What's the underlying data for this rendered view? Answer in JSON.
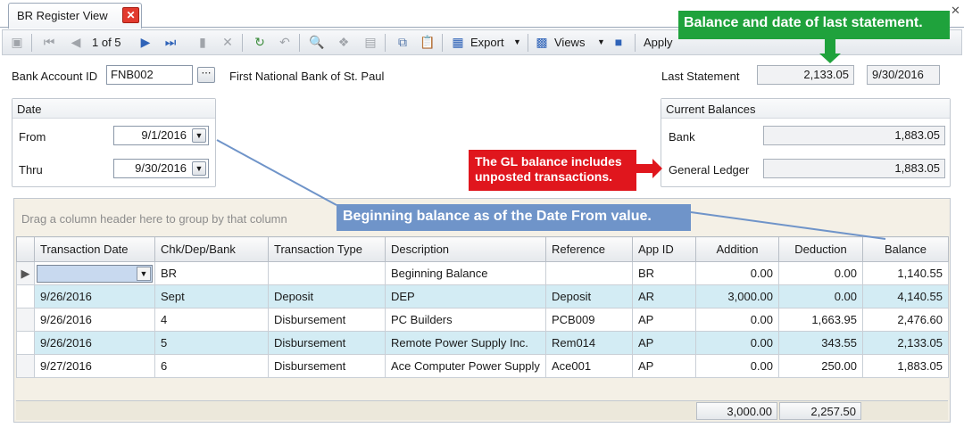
{
  "tab": {
    "label": "BR Register View",
    "close": "✕"
  },
  "window_close": "✕",
  "toolbar": {
    "record_position": "1 of 5",
    "export_label": "Export",
    "views_label": "Views",
    "apply_label": "Apply"
  },
  "header": {
    "bank_account_label": "Bank Account ID",
    "bank_account_value": "FNB002",
    "bank_name": "First National Bank of St. Paul",
    "last_statement_label": "Last Statement",
    "last_statement_amount": "2,133.05",
    "last_statement_date": "9/30/2016"
  },
  "date_group": {
    "title": "Date",
    "from_label": "From",
    "from_value": "9/1/2016",
    "thru_label": "Thru",
    "thru_value": "9/30/2016"
  },
  "balances_group": {
    "title": "Current Balances",
    "bank_label": "Bank",
    "bank_value": "1,883.05",
    "gl_label": "General Ledger",
    "gl_value": "1,883.05"
  },
  "grid": {
    "group_hint": "Drag a column header here to group by that column",
    "columns": [
      "Transaction Date",
      "Chk/Dep/Bank",
      "Transaction Type",
      "Description",
      "Reference",
      "App ID",
      "Addition",
      "Deduction",
      "Balance"
    ],
    "rows": [
      {
        "date": "",
        "chk": "BR",
        "type": "",
        "desc": "Beginning Balance",
        "ref": "",
        "app": "BR",
        "add": "0.00",
        "ded": "0.00",
        "bal": "1,140.55"
      },
      {
        "date": "9/26/2016",
        "chk": "Sept",
        "type": "Deposit",
        "desc": "DEP",
        "ref": "Deposit",
        "app": "AR",
        "add": "3,000.00",
        "ded": "0.00",
        "bal": "4,140.55"
      },
      {
        "date": "9/26/2016",
        "chk": "4",
        "type": "Disbursement",
        "desc": "PC Builders",
        "ref": "PCB009",
        "app": "AP",
        "add": "0.00",
        "ded": "1,663.95",
        "bal": "2,476.60"
      },
      {
        "date": "9/26/2016",
        "chk": "5",
        "type": "Disbursement",
        "desc": "Remote Power Supply Inc.",
        "ref": "Rem014",
        "app": "AP",
        "add": "0.00",
        "ded": "343.55",
        "bal": "2,133.05"
      },
      {
        "date": "9/27/2016",
        "chk": "6",
        "type": "Disbursement",
        "desc": "Ace Computer Power  Supply",
        "ref": "Ace001",
        "app": "AP",
        "add": "0.00",
        "ded": "250.00",
        "bal": "1,883.05"
      }
    ],
    "total_addition": "3,000.00",
    "total_deduction": "2,257.50"
  },
  "callouts": {
    "green": "Balance and date of last statement.",
    "red": "The GL balance includes unposted transactions.",
    "blue": "Beginning balance as of the Date From value."
  },
  "colors": {
    "green_callout": "#1fa23c",
    "red_callout": "#e0161d",
    "blue_callout": "#6f94c9",
    "alt_row": "#d3ecf4"
  }
}
